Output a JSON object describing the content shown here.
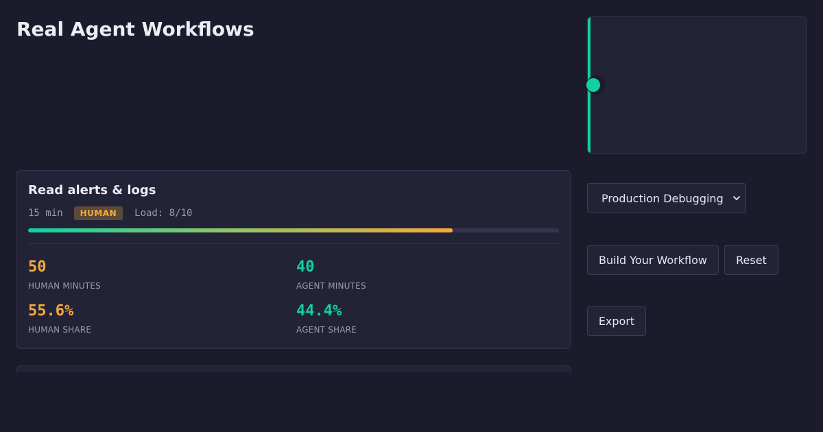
{
  "page": {
    "title": "Real Agent Workflows"
  },
  "task_card": {
    "title": "Read alerts & logs",
    "duration": "15 min",
    "owner_badge": "HUMAN",
    "load_label": "Load: 8/10",
    "load_value": 8,
    "load_max": 10
  },
  "stats": {
    "human_minutes": {
      "value": "50",
      "label": "HUMAN MINUTES"
    },
    "agent_minutes": {
      "value": "40",
      "label": "AGENT MINUTES"
    },
    "human_share": {
      "value": "55.6%",
      "label": "HUMAN SHARE"
    },
    "agent_share": {
      "value": "44.4%",
      "label": "AGENT SHARE"
    }
  },
  "controls": {
    "workflow_select": {
      "selected": "Production Debugging"
    },
    "build_button": "Build Your Workflow",
    "reset_button": "Reset",
    "export_button": "Export"
  },
  "colors": {
    "background": "#1b1b2c",
    "card": "#232338",
    "human": "#f5a93b",
    "agent": "#11d1a0"
  },
  "icons": {
    "select_arrow": "chevron-down-icon",
    "panel_handle": "drag-handle-icon"
  }
}
